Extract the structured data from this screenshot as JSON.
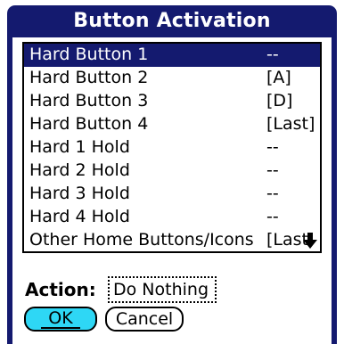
{
  "dialog": {
    "title": "Button Activation",
    "accent_color": "#141a6f",
    "ok_color": "#2ed7f5"
  },
  "list": {
    "rows": [
      {
        "name": "Hard Button 1",
        "value": "--",
        "selected": true
      },
      {
        "name": "Hard Button 2",
        "value": "[A]"
      },
      {
        "name": "Hard Button 3",
        "value": "[D]"
      },
      {
        "name": "Hard Button 4",
        "value": "[Last]"
      },
      {
        "name": "Hard 1 Hold",
        "value": "--"
      },
      {
        "name": "Hard 2 Hold",
        "value": "--"
      },
      {
        "name": "Hard 3 Hold",
        "value": "--"
      },
      {
        "name": "Hard 4 Hold",
        "value": "--"
      },
      {
        "name": "Other Home Buttons/Icons",
        "value": "[Last",
        "scroll_icon": "scroll-down-arrow-icon"
      }
    ]
  },
  "action": {
    "label": "Action:",
    "value": "Do Nothing"
  },
  "buttons": {
    "ok": "OK",
    "cancel": "Cancel"
  }
}
